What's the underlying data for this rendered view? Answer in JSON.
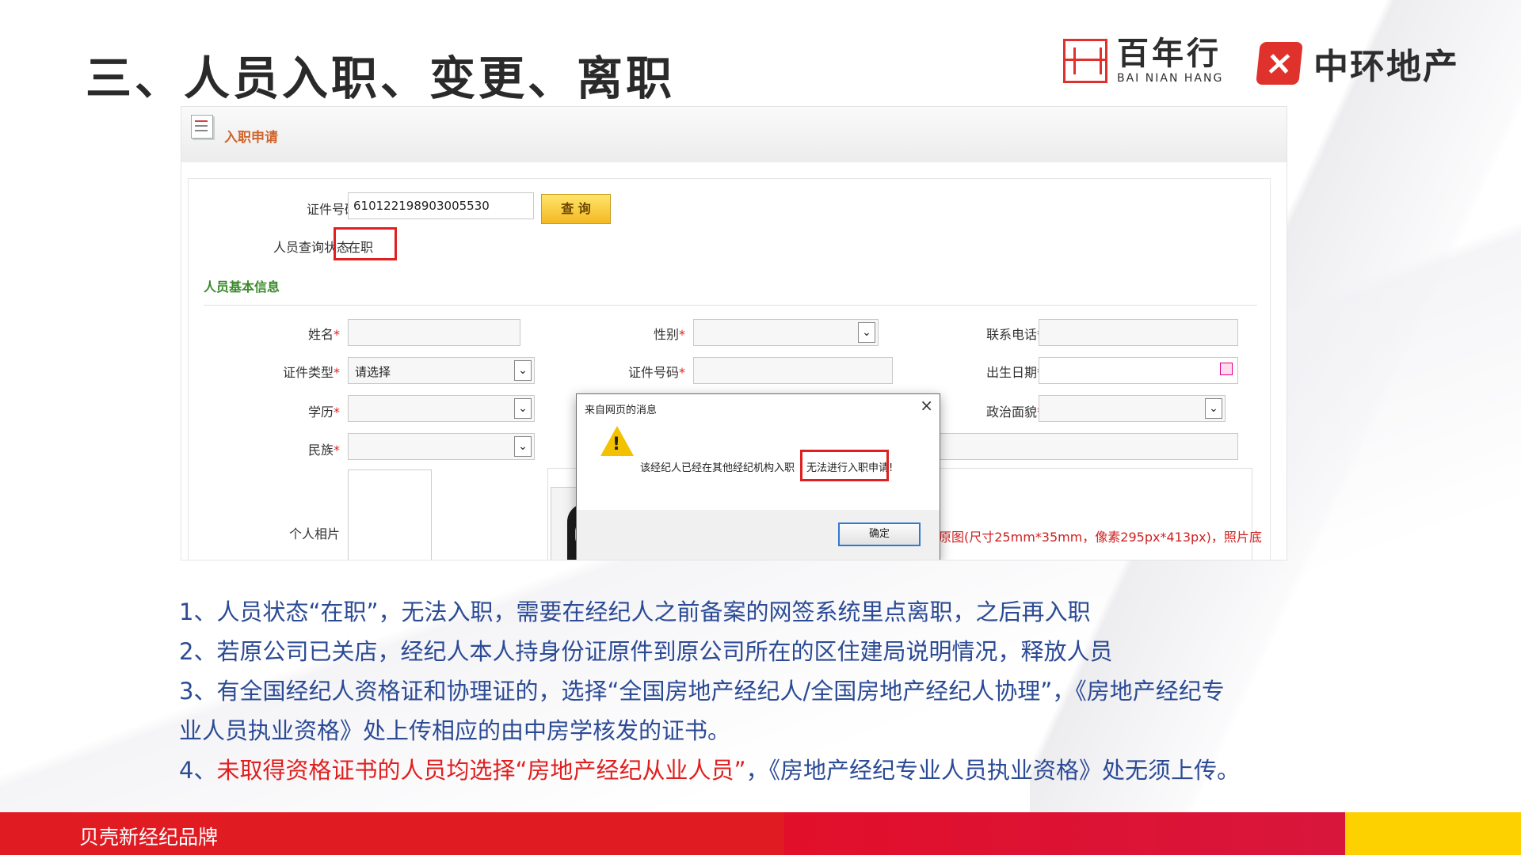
{
  "slide": {
    "title": "三、人员入职、变更、离职",
    "logo_bnh_cn": "百年行",
    "logo_bnh_en": "BAI NIAN HANG",
    "logo_zh_cn": "中环地产",
    "footer_brand": "贝壳新经纪品牌"
  },
  "screenshot": {
    "window_title": "入职申请",
    "query": {
      "id_label": "证件号码",
      "id_value": "610122198903005530",
      "query_button": "查 询",
      "status_label": "人员查询状态",
      "status_value": "在职"
    },
    "section_title": "人员基本信息",
    "fields": {
      "name_label": "姓名",
      "gender_label": "性别",
      "phone_label": "联系电话",
      "id_type_label": "证件类型",
      "id_type_value": "请选择",
      "id_no_label": "证件号码",
      "birth_label": "出生日期",
      "edu_label": "学历",
      "political_label": "政治面貌",
      "ethnic_label": "民族",
      "photo_label": "个人相片",
      "photo_note": "原图(尺寸25mm*35mm，像素295px*413px)，照片底",
      "required_mark": "*"
    },
    "dialog": {
      "title": "来自网页的消息",
      "close": "×",
      "message_part1": "该经纪人已经在其他经纪机构入职",
      "message_part2": "无法进行入职申请!",
      "ok_button": "确定"
    }
  },
  "notes": {
    "line1": "1、人员状态“在职”，无法入职，需要在经纪人之前备案的网签系统里点离职，之后再入职",
    "line2": "2、若原公司已关店，经纪人本人持身份证原件到原公司所在的区住建局说明情况，释放人员",
    "line3a": "3、有全国经纪人资格证和协理证的，选择“全国房地产经纪人/全国房地产经纪人协理”，《房地产经纪专",
    "line3b": "业人员执业资格》处上传相应的由中房学核发的证书。",
    "line4_prefix": "4、",
    "line4_red": "未取得资格证书的人员均选择“房地产经纪从业人员”",
    "line4_rest": "，《房地产经纪专业人员执业资格》处无须上传。"
  },
  "colors": {
    "accent_red": "#e11b22",
    "note_blue": "#2c4b95",
    "footer_yellow": "#fdd100"
  }
}
